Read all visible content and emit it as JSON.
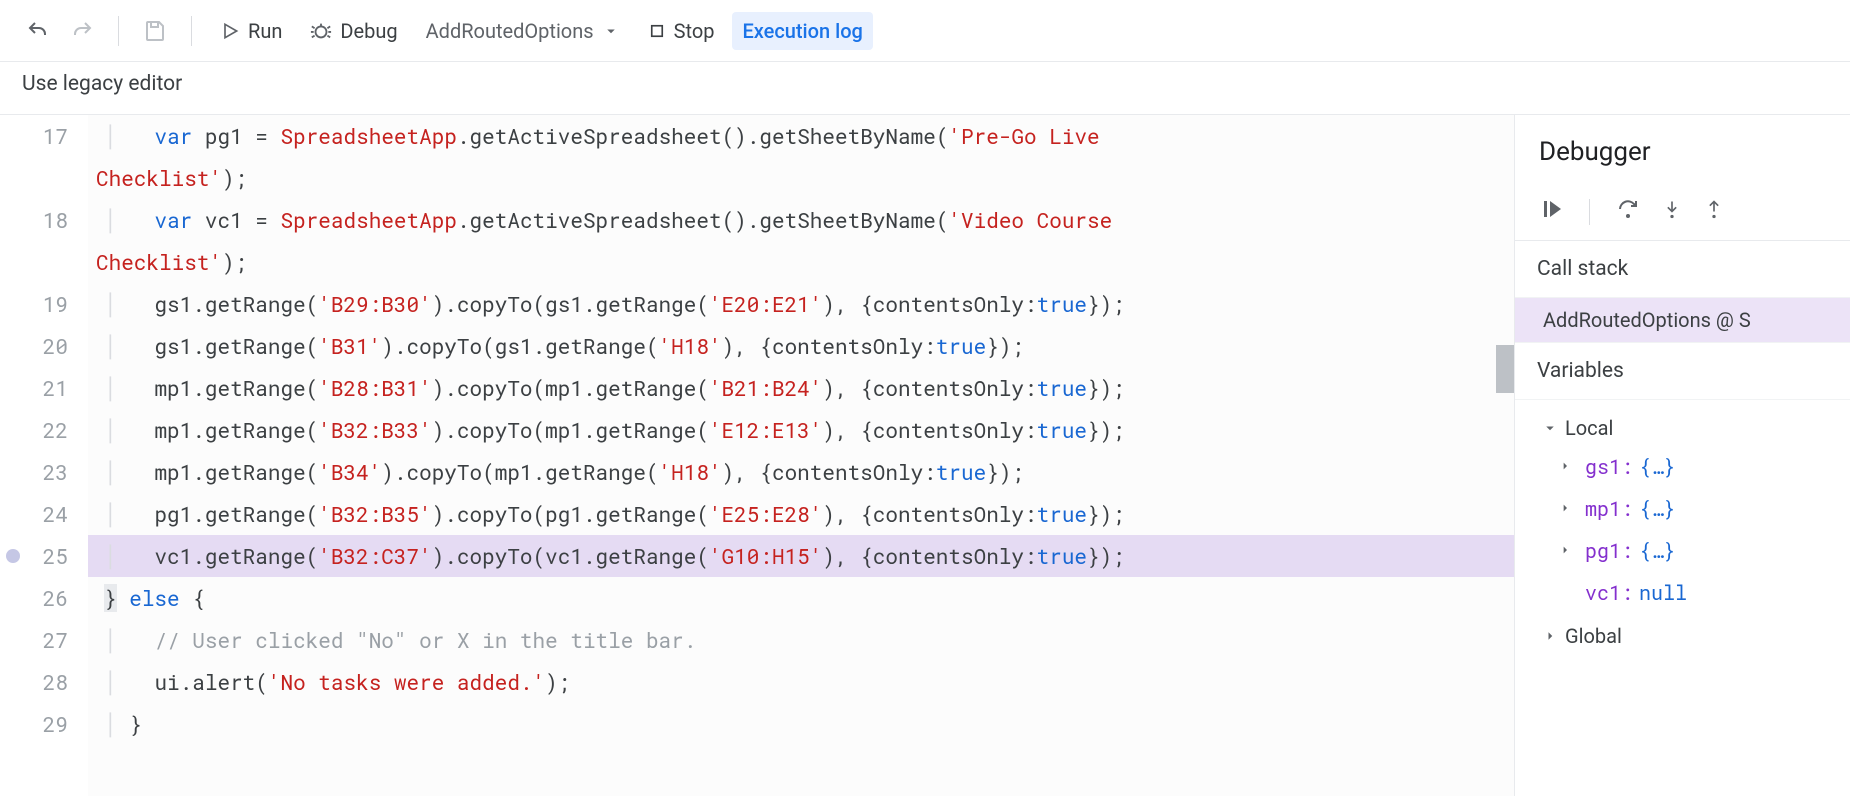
{
  "toolbar": {
    "run_label": "Run",
    "debug_label": "Debug",
    "function_selected": "AddRoutedOptions",
    "stop_label": "Stop",
    "exec_log_label": "Execution log"
  },
  "subbar": {
    "legacy_label": "Use legacy editor"
  },
  "editor": {
    "lines": [
      {
        "n": 17,
        "wrap": false,
        "bp": false,
        "hl": false,
        "segs": [
          {
            "t": "│ ",
            "c": "guide"
          },
          {
            "t": "  ",
            "c": "plain"
          },
          {
            "t": "var",
            "c": "kw"
          },
          {
            "t": " pg1 = ",
            "c": "plain"
          },
          {
            "t": "SpreadsheetApp",
            "c": "cls"
          },
          {
            "t": ".getActiveSpreadsheet().getSheetByName(",
            "c": "plain"
          },
          {
            "t": "'Pre-Go Live ",
            "c": "str"
          }
        ]
      },
      {
        "n": null,
        "wrap": true,
        "bp": false,
        "hl": false,
        "segs": [
          {
            "t": "Checklist'",
            "c": "str"
          },
          {
            "t": ");",
            "c": "plain"
          }
        ]
      },
      {
        "n": 18,
        "wrap": false,
        "bp": false,
        "hl": false,
        "segs": [
          {
            "t": "│ ",
            "c": "guide"
          },
          {
            "t": "  ",
            "c": "plain"
          },
          {
            "t": "var",
            "c": "kw"
          },
          {
            "t": " vc1 = ",
            "c": "plain"
          },
          {
            "t": "SpreadsheetApp",
            "c": "cls"
          },
          {
            "t": ".getActiveSpreadsheet().getSheetByName(",
            "c": "plain"
          },
          {
            "t": "'Video Course ",
            "c": "str"
          }
        ]
      },
      {
        "n": null,
        "wrap": true,
        "bp": false,
        "hl": false,
        "segs": [
          {
            "t": "Checklist'",
            "c": "str"
          },
          {
            "t": ");",
            "c": "plain"
          }
        ]
      },
      {
        "n": 19,
        "wrap": false,
        "bp": false,
        "hl": false,
        "segs": [
          {
            "t": "│ ",
            "c": "guide"
          },
          {
            "t": "  gs1.getRange(",
            "c": "plain"
          },
          {
            "t": "'B29:B30'",
            "c": "str"
          },
          {
            "t": ").copyTo(gs1.getRange(",
            "c": "plain"
          },
          {
            "t": "'E20:E21'",
            "c": "str"
          },
          {
            "t": "), {contentsOnly:",
            "c": "plain"
          },
          {
            "t": "true",
            "c": "bool"
          },
          {
            "t": "});",
            "c": "plain"
          }
        ]
      },
      {
        "n": 20,
        "wrap": false,
        "bp": false,
        "hl": false,
        "segs": [
          {
            "t": "│ ",
            "c": "guide"
          },
          {
            "t": "  gs1.getRange(",
            "c": "plain"
          },
          {
            "t": "'B31'",
            "c": "str"
          },
          {
            "t": ").copyTo(gs1.getRange(",
            "c": "plain"
          },
          {
            "t": "'H18'",
            "c": "str"
          },
          {
            "t": "), {contentsOnly:",
            "c": "plain"
          },
          {
            "t": "true",
            "c": "bool"
          },
          {
            "t": "});",
            "c": "plain"
          }
        ]
      },
      {
        "n": 21,
        "wrap": false,
        "bp": false,
        "hl": false,
        "segs": [
          {
            "t": "│ ",
            "c": "guide"
          },
          {
            "t": "  mp1.getRange(",
            "c": "plain"
          },
          {
            "t": "'B28:B31'",
            "c": "str"
          },
          {
            "t": ").copyTo(mp1.getRange(",
            "c": "plain"
          },
          {
            "t": "'B21:B24'",
            "c": "str"
          },
          {
            "t": "), {contentsOnly:",
            "c": "plain"
          },
          {
            "t": "true",
            "c": "bool"
          },
          {
            "t": "});",
            "c": "plain"
          }
        ]
      },
      {
        "n": 22,
        "wrap": false,
        "bp": false,
        "hl": false,
        "segs": [
          {
            "t": "│ ",
            "c": "guide"
          },
          {
            "t": "  mp1.getRange(",
            "c": "plain"
          },
          {
            "t": "'B32:B33'",
            "c": "str"
          },
          {
            "t": ").copyTo(mp1.getRange(",
            "c": "plain"
          },
          {
            "t": "'E12:E13'",
            "c": "str"
          },
          {
            "t": "), {contentsOnly:",
            "c": "plain"
          },
          {
            "t": "true",
            "c": "bool"
          },
          {
            "t": "});",
            "c": "plain"
          }
        ]
      },
      {
        "n": 23,
        "wrap": false,
        "bp": false,
        "hl": false,
        "segs": [
          {
            "t": "│ ",
            "c": "guide"
          },
          {
            "t": "  mp1.getRange(",
            "c": "plain"
          },
          {
            "t": "'B34'",
            "c": "str"
          },
          {
            "t": ").copyTo(mp1.getRange(",
            "c": "plain"
          },
          {
            "t": "'H18'",
            "c": "str"
          },
          {
            "t": "), {contentsOnly:",
            "c": "plain"
          },
          {
            "t": "true",
            "c": "bool"
          },
          {
            "t": "});",
            "c": "plain"
          }
        ]
      },
      {
        "n": 24,
        "wrap": false,
        "bp": false,
        "hl": false,
        "segs": [
          {
            "t": "│ ",
            "c": "guide"
          },
          {
            "t": "  pg1.getRange(",
            "c": "plain"
          },
          {
            "t": "'B32:B35'",
            "c": "str"
          },
          {
            "t": ").copyTo(pg1.getRange(",
            "c": "plain"
          },
          {
            "t": "'E25:E28'",
            "c": "str"
          },
          {
            "t": "), {contentsOnly:",
            "c": "plain"
          },
          {
            "t": "true",
            "c": "bool"
          },
          {
            "t": "});",
            "c": "plain"
          }
        ]
      },
      {
        "n": 25,
        "wrap": false,
        "bp": true,
        "hl": true,
        "segs": [
          {
            "t": "│ ",
            "c": "guide"
          },
          {
            "t": "  vc1.getRange(",
            "c": "plain"
          },
          {
            "t": "'B32:C37'",
            "c": "str"
          },
          {
            "t": ").copyTo(vc1.getRange(",
            "c": "plain"
          },
          {
            "t": "'G10:H15'",
            "c": "str"
          },
          {
            "t": "), {contentsOnly:",
            "c": "plain"
          },
          {
            "t": "true",
            "c": "bool"
          },
          {
            "t": "});",
            "c": "plain"
          }
        ]
      },
      {
        "n": 26,
        "wrap": false,
        "bp": false,
        "hl": false,
        "segs": [
          {
            "t": "}",
            "c": "brace"
          },
          {
            "t": " ",
            "c": "plain"
          },
          {
            "t": "else",
            "c": "kw"
          },
          {
            "t": " {",
            "c": "plain"
          }
        ]
      },
      {
        "n": 27,
        "wrap": false,
        "bp": false,
        "hl": false,
        "segs": [
          {
            "t": "│ ",
            "c": "guide"
          },
          {
            "t": "  ",
            "c": "plain"
          },
          {
            "t": "// User clicked \"No\" or X in the title bar.",
            "c": "comment"
          }
        ]
      },
      {
        "n": 28,
        "wrap": false,
        "bp": false,
        "hl": false,
        "segs": [
          {
            "t": "│ ",
            "c": "guide"
          },
          {
            "t": "  ui.alert(",
            "c": "plain"
          },
          {
            "t": "'No tasks were added.'",
            "c": "str"
          },
          {
            "t": ");",
            "c": "plain"
          }
        ]
      },
      {
        "n": 29,
        "wrap": false,
        "bp": false,
        "hl": false,
        "segs": [
          {
            "t": "│ ",
            "c": "guide"
          },
          {
            "t": "}",
            "c": "plain"
          }
        ]
      }
    ]
  },
  "debugger": {
    "title": "Debugger",
    "call_stack_label": "Call stack",
    "stack_frame": "AddRoutedOptions @ S",
    "variables_label": "Variables",
    "scope_local": "Local",
    "scope_global": "Global",
    "vars": [
      {
        "name": "gs1",
        "val": "{…}",
        "expandable": true
      },
      {
        "name": "mp1",
        "val": "{…}",
        "expandable": true
      },
      {
        "name": "pg1",
        "val": "{…}",
        "expandable": true
      },
      {
        "name": "vc1",
        "val": "null",
        "expandable": false
      }
    ]
  }
}
